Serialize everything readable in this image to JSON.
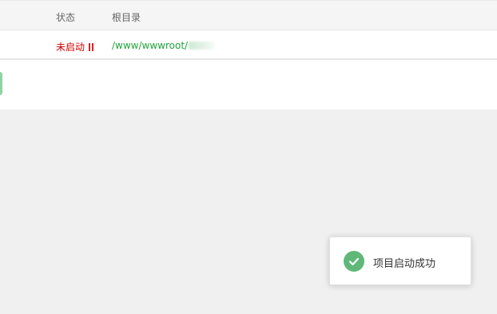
{
  "table": {
    "headers": {
      "status": "状态",
      "root_dir": "根目录"
    },
    "rows": [
      {
        "status": "未启动",
        "root_dir": "/www/wwwroot/"
      }
    ]
  },
  "toast": {
    "message": "项目启动成功",
    "icon": "check-circle-icon",
    "color": "#5fb878"
  },
  "colors": {
    "status_stopped": "#cc0000",
    "path_link": "#20a53a",
    "accent": "#8fd3a2"
  }
}
